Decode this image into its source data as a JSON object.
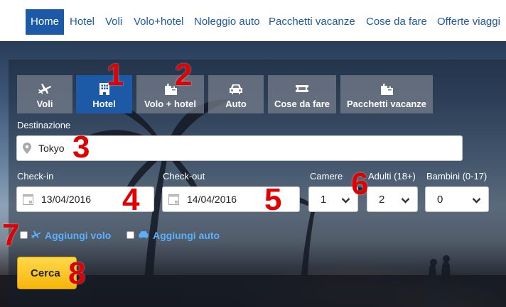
{
  "nav": {
    "items": [
      {
        "label": "Home",
        "active": true
      },
      {
        "label": "Hotel"
      },
      {
        "label": "Voli"
      },
      {
        "label": "Volo+hotel"
      },
      {
        "label": "Noleggio auto"
      },
      {
        "label": "Pacchetti vacanze"
      },
      {
        "label": "Cose da fare"
      },
      {
        "label": "Offerte viaggi"
      }
    ]
  },
  "tabs": [
    {
      "label": "Voli",
      "icon": "plane-icon"
    },
    {
      "label": "Hotel",
      "icon": "building-icon",
      "active": true
    },
    {
      "label": "Volo + hotel",
      "icon": "luggage-icon"
    },
    {
      "label": "Auto",
      "icon": "car-icon"
    },
    {
      "label": "Cose da fare",
      "icon": "ticket-icon"
    },
    {
      "label": "Pacchetti vacanze",
      "icon": "luggage-icon"
    }
  ],
  "form": {
    "destination_label": "Destinazione",
    "destination_value": "Tokyo",
    "checkin_label": "Check-in",
    "checkin_value": "13/04/2016",
    "checkout_label": "Check-out",
    "checkout_value": "14/04/2016",
    "rooms_label": "Camere",
    "rooms_value": "1",
    "adults_label": "Adulti (18+)",
    "adults_value": "2",
    "children_label": "Bambini (0-17)",
    "children_value": "0",
    "add_flight_label": "Aggiungi volo",
    "add_car_label": "Aggiungi auto",
    "search_label": "Cerca"
  },
  "annotations": [
    "1",
    "2",
    "3",
    "4",
    "5",
    "6",
    "7",
    "8"
  ],
  "colors": {
    "brand_blue": "#1c5aa8",
    "link_blue": "#5ab0ff",
    "search_yellow": "#f6b60a",
    "annotation_red": "#e00000"
  }
}
